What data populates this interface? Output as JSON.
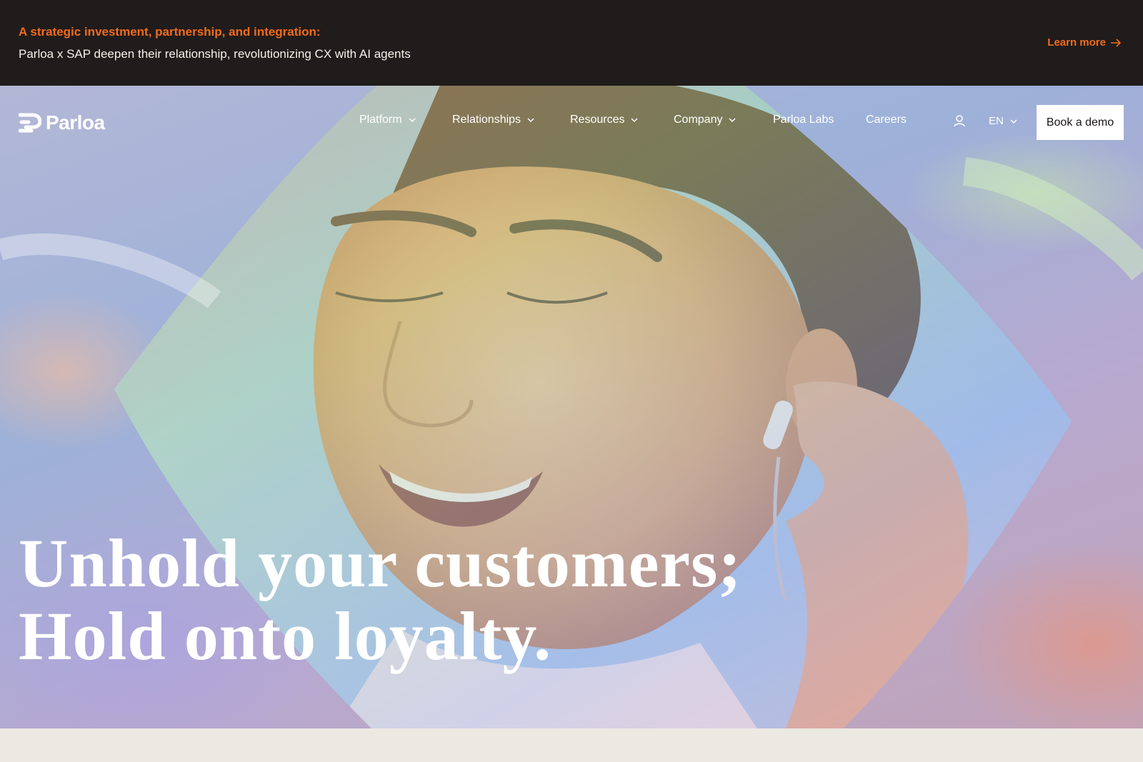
{
  "announcement": {
    "kicker": "A strategic investment, partnership, and integration:",
    "headline": "Parloa x SAP deepen their relationship, revolutionizing CX with AI agents",
    "link_label": "Learn more"
  },
  "brand": {
    "name": "Parloa"
  },
  "nav": {
    "items": [
      {
        "label": "Platform"
      },
      {
        "label": "Relationships"
      },
      {
        "label": "Resources"
      },
      {
        "label": "Company"
      },
      {
        "label": "Parloa Labs"
      },
      {
        "label": "Careers"
      }
    ],
    "language": "EN",
    "cta": "Book a demo"
  },
  "hero": {
    "line1": "Unhold your customers;",
    "line2": "Hold onto loyalty."
  },
  "colors": {
    "accent": "#F26B1D",
    "banner_bg": "#201C1B",
    "page_bg": "#ECE9E2"
  },
  "icons": [
    "parloa-logo-icon",
    "chevron-down-icon",
    "user-icon",
    "arrow-right-icon"
  ]
}
